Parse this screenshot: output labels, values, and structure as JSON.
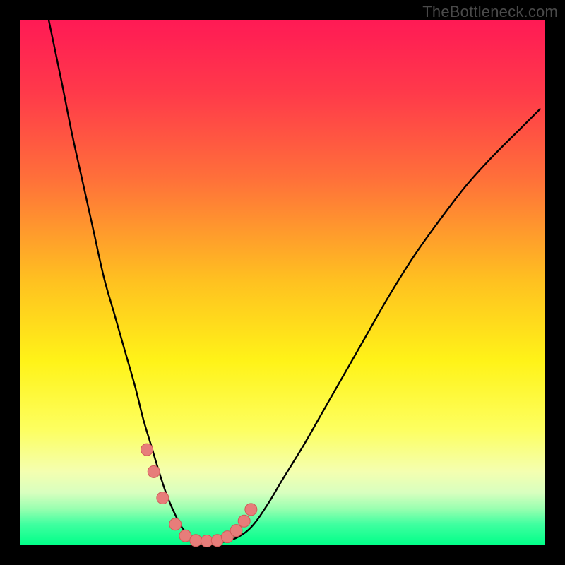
{
  "watermark": "TheBottleneck.com",
  "colors": {
    "frame": "#000000",
    "gradient_stops": [
      {
        "pct": 0,
        "color": "#ff1a55"
      },
      {
        "pct": 14,
        "color": "#ff3a4a"
      },
      {
        "pct": 30,
        "color": "#ff6f3a"
      },
      {
        "pct": 50,
        "color": "#ffc220"
      },
      {
        "pct": 65,
        "color": "#fff318"
      },
      {
        "pct": 78,
        "color": "#fdff60"
      },
      {
        "pct": 86,
        "color": "#f4ffb0"
      },
      {
        "pct": 90,
        "color": "#d8ffbf"
      },
      {
        "pct": 93,
        "color": "#9affb0"
      },
      {
        "pct": 96,
        "color": "#40ffa0"
      },
      {
        "pct": 100,
        "color": "#00ff88"
      }
    ],
    "curve": "#000000",
    "marker_fill": "#e77d7a",
    "marker_stroke": "#d05a58"
  },
  "chart_data": {
    "type": "line",
    "title": "",
    "xlabel": "",
    "ylabel": "",
    "xlim": [
      0,
      100
    ],
    "ylim": [
      0,
      100
    ],
    "note": "x and y are percentages of the plot area. y=0 at bottom, y=100 at top. Curve is a V-shaped bottleneck profile with a flat-bottom optimum region.",
    "series": [
      {
        "name": "bottleneck-curve",
        "x": [
          5.5,
          8,
          10,
          12,
          14,
          16,
          18,
          20,
          22,
          23.5,
          25,
          26.5,
          28,
          29.5,
          31,
          33,
          35.5,
          38,
          41,
          44,
          47,
          50,
          54,
          58,
          62,
          66,
          70,
          75,
          80,
          85,
          90,
          95,
          99
        ],
        "y": [
          100,
          88,
          78,
          69,
          60,
          51,
          44,
          37,
          30,
          24,
          19,
          14,
          9.5,
          6,
          3.2,
          1.3,
          0.5,
          0.5,
          1.3,
          3.4,
          7.5,
          12.5,
          19,
          26,
          33,
          40,
          47,
          55,
          62,
          68.5,
          74,
          79,
          83
        ]
      }
    ],
    "markers": {
      "name": "highlight-points",
      "x": [
        24.2,
        25.5,
        27.2,
        29.6,
        31.5,
        33.5,
        35.6,
        37.6,
        39.5,
        41.2,
        42.7,
        44.0
      ],
      "y": [
        18.2,
        14.0,
        9.0,
        4.0,
        1.8,
        0.9,
        0.8,
        0.9,
        1.6,
        2.8,
        4.6,
        6.8
      ]
    }
  }
}
